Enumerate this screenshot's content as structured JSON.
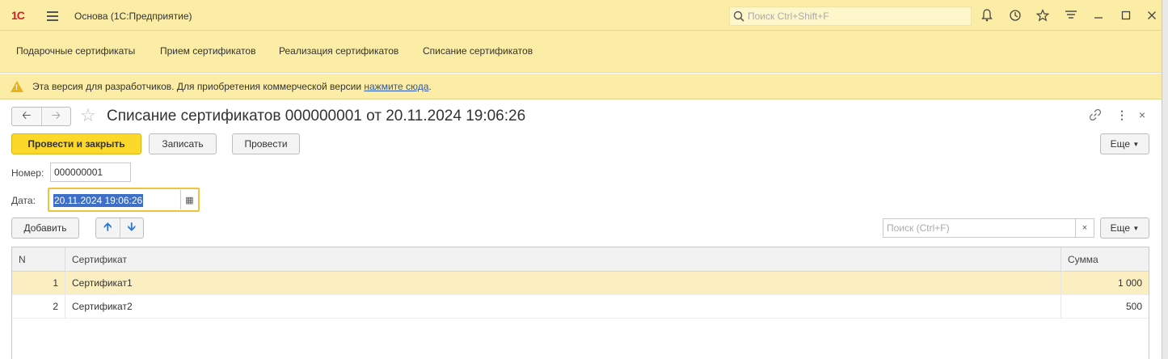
{
  "window": {
    "logo": "1С",
    "title": "Основа  (1С:Предприятие)",
    "search_placeholder": "Поиск Ctrl+Shift+F"
  },
  "sections": [
    "Подарочные сертификаты",
    "Прием сертификатов",
    "Реализация сертификатов",
    "Списание сертификатов"
  ],
  "banner": {
    "text": "Эта версия для разработчиков. Для приобретения коммерческой версии ",
    "link": "нажмите сюда",
    "tail": "."
  },
  "form": {
    "title": "Списание сертификатов 000000001 от 20.11.2024 19:06:26",
    "buttons": {
      "post_close": "Провести и закрыть",
      "save": "Записать",
      "post": "Провести",
      "more": "Еще"
    },
    "number_label": "Номер:",
    "number_value": "000000001",
    "date_label": "Дата:",
    "date_value": "20.11.2024 19:06:26"
  },
  "table": {
    "add_button": "Добавить",
    "search_placeholder": "Поиск (Ctrl+F)",
    "more": "Еще",
    "columns": [
      "N",
      "Сертификат",
      "Сумма"
    ],
    "rows": [
      {
        "n": "1",
        "cert": "Сертификат1",
        "sum": "1 000"
      },
      {
        "n": "2",
        "cert": "Сертификат2",
        "sum": "500"
      }
    ]
  }
}
